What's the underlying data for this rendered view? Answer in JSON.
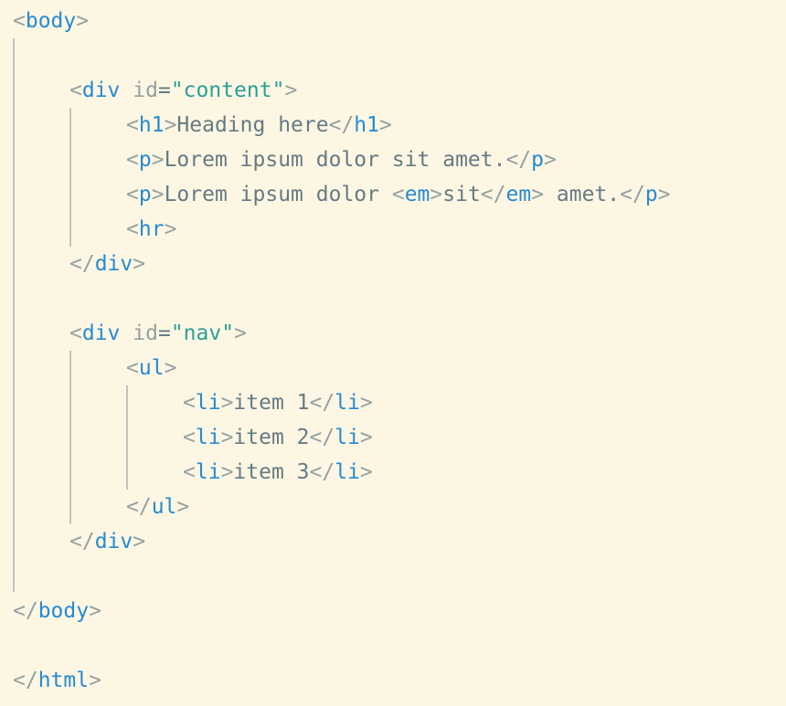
{
  "editor": {
    "theme_colors": {
      "background": "#fdf6e3",
      "tag": "#268bd2",
      "bracket": "#93a1a1",
      "attribute": "#93a1a1",
      "string": "#2aa198",
      "text": "#657b83"
    },
    "lines": [
      {
        "segments": [
          [
            "br",
            "<"
          ],
          [
            "tag",
            "body"
          ],
          [
            "br",
            ">"
          ]
        ]
      },
      {
        "segments": []
      },
      {
        "segments": [
          [
            "br",
            "<"
          ],
          [
            "tag",
            "div"
          ],
          [
            "attr",
            " id"
          ],
          [
            "eq",
            "="
          ],
          [
            "str",
            "\"content\""
          ],
          [
            "br",
            ">"
          ]
        ]
      },
      {
        "segments": [
          [
            "br",
            "<"
          ],
          [
            "tag",
            "h1"
          ],
          [
            "br",
            ">"
          ],
          [
            "txt",
            "Heading here"
          ],
          [
            "br",
            "</"
          ],
          [
            "tag",
            "h1"
          ],
          [
            "br",
            ">"
          ]
        ]
      },
      {
        "segments": [
          [
            "br",
            "<"
          ],
          [
            "tag",
            "p"
          ],
          [
            "br",
            ">"
          ],
          [
            "txt",
            "Lorem ipsum dolor sit amet."
          ],
          [
            "br",
            "</"
          ],
          [
            "tag",
            "p"
          ],
          [
            "br",
            ">"
          ]
        ]
      },
      {
        "segments": [
          [
            "br",
            "<"
          ],
          [
            "tag",
            "p"
          ],
          [
            "br",
            ">"
          ],
          [
            "txt",
            "Lorem ipsum dolor "
          ],
          [
            "br",
            "<"
          ],
          [
            "tag",
            "em"
          ],
          [
            "br",
            ">"
          ],
          [
            "txt",
            "sit"
          ],
          [
            "br",
            "</"
          ],
          [
            "tag",
            "em"
          ],
          [
            "br",
            ">"
          ],
          [
            "txt",
            " amet."
          ],
          [
            "br",
            "</"
          ],
          [
            "tag",
            "p"
          ],
          [
            "br",
            ">"
          ]
        ]
      },
      {
        "segments": [
          [
            "br",
            "<"
          ],
          [
            "tag",
            "hr"
          ],
          [
            "br",
            ">"
          ]
        ]
      },
      {
        "segments": [
          [
            "br",
            "</"
          ],
          [
            "tag",
            "div"
          ],
          [
            "br",
            ">"
          ]
        ]
      },
      {
        "segments": []
      },
      {
        "segments": [
          [
            "br",
            "<"
          ],
          [
            "tag",
            "div"
          ],
          [
            "attr",
            " id"
          ],
          [
            "eq",
            "="
          ],
          [
            "str",
            "\"nav\""
          ],
          [
            "br",
            ">"
          ]
        ]
      },
      {
        "segments": [
          [
            "br",
            "<"
          ],
          [
            "tag",
            "ul"
          ],
          [
            "br",
            ">"
          ]
        ]
      },
      {
        "segments": [
          [
            "br",
            "<"
          ],
          [
            "tag",
            "li"
          ],
          [
            "br",
            ">"
          ],
          [
            "txt",
            "item 1"
          ],
          [
            "br",
            "</"
          ],
          [
            "tag",
            "li"
          ],
          [
            "br",
            ">"
          ]
        ]
      },
      {
        "segments": [
          [
            "br",
            "<"
          ],
          [
            "tag",
            "li"
          ],
          [
            "br",
            ">"
          ],
          [
            "txt",
            "item 2"
          ],
          [
            "br",
            "</"
          ],
          [
            "tag",
            "li"
          ],
          [
            "br",
            ">"
          ]
        ]
      },
      {
        "segments": [
          [
            "br",
            "<"
          ],
          [
            "tag",
            "li"
          ],
          [
            "br",
            ">"
          ],
          [
            "txt",
            "item 3"
          ],
          [
            "br",
            "</"
          ],
          [
            "tag",
            "li"
          ],
          [
            "br",
            ">"
          ]
        ]
      },
      {
        "segments": [
          [
            "br",
            "</"
          ],
          [
            "tag",
            "ul"
          ],
          [
            "br",
            ">"
          ]
        ]
      },
      {
        "segments": [
          [
            "br",
            "</"
          ],
          [
            "tag",
            "div"
          ],
          [
            "br",
            ">"
          ]
        ]
      },
      {
        "segments": []
      },
      {
        "segments": [
          [
            "br",
            "</"
          ],
          [
            "tag",
            "body"
          ],
          [
            "br",
            ">"
          ]
        ]
      },
      {
        "segments": []
      },
      {
        "segments": [
          [
            "br",
            "</"
          ],
          [
            "tag",
            "html"
          ],
          [
            "br",
            ">"
          ]
        ]
      }
    ]
  }
}
